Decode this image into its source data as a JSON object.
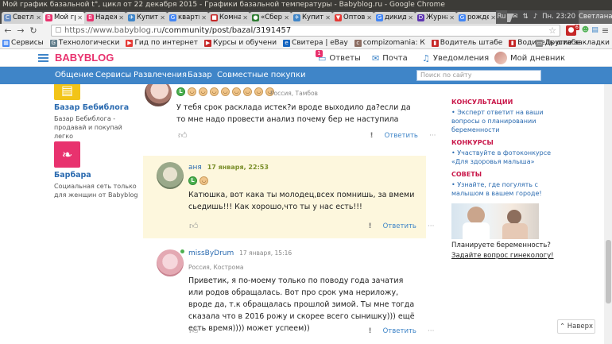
{
  "window": {
    "title": "Мой график базальной t°, цикл от 22 декабря 2015 - Графики базальной температуры - Babyblog.ru - Google Chrome",
    "lang": "Ru",
    "clock": "Пн. 23:20",
    "user": "Светлана"
  },
  "tabs": [
    {
      "label": "Светла",
      "color": "#6b8fc4",
      "glyph": "С"
    },
    {
      "label": "Мой гр",
      "color": "#e8326e",
      "glyph": "B",
      "active": true
    },
    {
      "label": "Надеж",
      "color": "#e8326e",
      "glyph": "B"
    },
    {
      "label": "Купить",
      "color": "#3f85c8",
      "glyph": "✈"
    },
    {
      "label": "кварти",
      "color": "#4285f4",
      "glyph": "G"
    },
    {
      "label": "Комна",
      "color": "#c62828",
      "glyph": "■"
    },
    {
      "label": "«Сбер",
      "color": "#2e7d32",
      "glyph": "●"
    },
    {
      "label": "Купить",
      "color": "#3f85c8",
      "glyph": "✈"
    },
    {
      "label": "Оптов",
      "color": "#e53935",
      "glyph": "▼"
    },
    {
      "label": "дикид",
      "color": "#4285f4",
      "glyph": "G"
    },
    {
      "label": "Журна",
      "color": "#5e35b1",
      "glyph": "D"
    },
    {
      "label": "рожде",
      "color": "#4285f4",
      "glyph": "G"
    }
  ],
  "toolbar": {
    "url_host": "https://www.babyblog.ru",
    "url_path": "/community/post/bazal/3191457",
    "ext_badge": "6"
  },
  "bookmarks": [
    {
      "label": "Сервисы",
      "color": "#4285f4",
      "glyph": "▦"
    },
    {
      "label": "Технологически",
      "color": "#607d8b",
      "glyph": "G"
    },
    {
      "label": "Гид по интернет",
      "color": "#e53935",
      "glyph": "▶"
    },
    {
      "label": "Курсы и обучени",
      "color": "#c62828",
      "glyph": "▶"
    },
    {
      "label": "Свитера | eBay",
      "color": "#1565c0",
      "glyph": "e"
    },
    {
      "label": "compizomania: К",
      "color": "#8d6e63",
      "glyph": "c"
    },
    {
      "label": "Водитель штабе",
      "color": "#c62828",
      "glyph": "▮"
    },
    {
      "label": "Водитель штабе",
      "color": "#c62828",
      "glyph": "▮"
    }
  ],
  "bookmarks_other": "Другие закладки",
  "site": {
    "logo": "BABYBLOG",
    "header": {
      "answers": "Ответы",
      "answers_badge": "1",
      "mail": "Почта",
      "notifications": "Уведомления",
      "diary": "Мой дневник"
    },
    "nav": [
      "Общение",
      "Сервисы",
      "Развлечения",
      "Базар",
      "Совместные покупки"
    ],
    "search_placeholder": "Поиск по сайту"
  },
  "sidebar": [
    {
      "title": "Базар Бебиблога",
      "desc": "Базар Бебиблога - продавай и покупай легко",
      "color": "#f2c418"
    },
    {
      "title": "Барбара",
      "desc": "Социальная сеть только для женщин от Babyblog",
      "color": "#e8326e"
    }
  ],
  "comments": [
    {
      "name": "",
      "date": "",
      "location": "Россия, Тамбов",
      "text": "У тебя срок расклада истек?и вроде выходило да?если да то мне надо провести анализ почему бер не наступила",
      "reply": "Ответить"
    },
    {
      "name": "аня",
      "date": "17 января, 22:53",
      "location": "",
      "text": "Катюшка, вот кака ты молодец,всех помнишь, за вмеми сьедишь!!! Как хорошо,что ты у нас есть!!!",
      "reply": "Ответить"
    },
    {
      "name": "missByDrum",
      "date": "17 января, 15:16",
      "location": "Россия, Кострома",
      "text": "Приветик, я по-моему только по поводу года зачатия или родов обращалась. Вот про срок ума нериложу, вроде да, т.к обращалась прошлой зимой. Ты мне тогда сказала что в 2016 рожу и скорее всего сынишку))) ещё есть время)))) может успеем))",
      "reply": "Ответить"
    }
  ],
  "common": {
    "more": "···",
    "excl": "!",
    "emo_l": "L"
  },
  "right": {
    "consult_title": "КОНСУЛЬТАЦИИ",
    "consult_link": "• Эксперт ответит на ваши вопросы о планировании беременности",
    "contest_title": "КОНКУРСЫ",
    "contest_link": "• Участвуйте в фотоконкурсе «Для здоровья малыша»",
    "tips_title": "СОВЕТЫ",
    "tips_link": "• Узнайте, где погулять с малышом в вашем городе!",
    "q1": "Планируете беременность?",
    "q2": "Задайте вопрос гинекологу!"
  },
  "back_up": "Наверх"
}
